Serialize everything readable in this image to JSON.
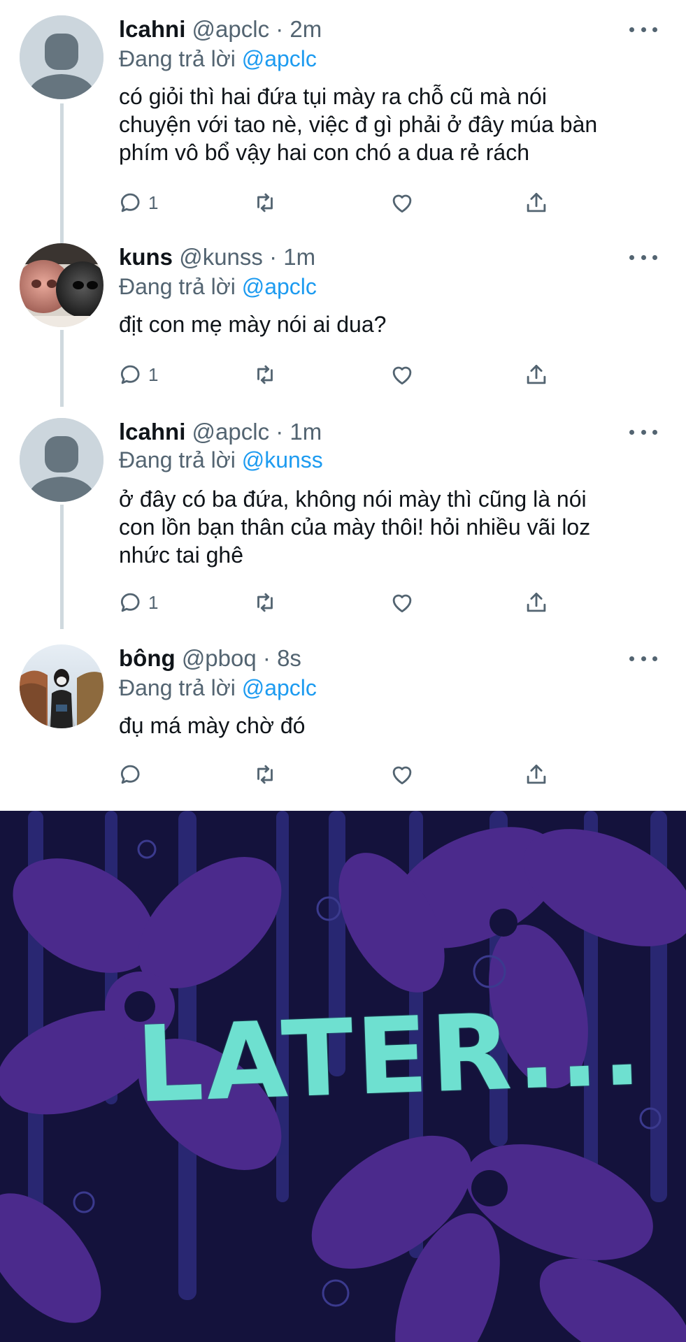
{
  "tweets": [
    {
      "name": "lcahni",
      "handle": "@apclc",
      "dot": "·",
      "time": "2m",
      "reply_prefix": "Đang trả lời",
      "reply_to": "@apclc",
      "lines": [
        "có giỏi thì hai đứa tụi mày ra chỗ cũ mà nói",
        "chuyện với tao nè, việc đ gì phải ở đây múa bàn",
        "phím vô bổ vậy hai con chó a dua rẻ rách"
      ],
      "reply_count": "1",
      "avatar": "default-avatar"
    },
    {
      "name": "kuns",
      "handle": "@kunss",
      "dot": "·",
      "time": "1m",
      "reply_prefix": "Đang trả lời",
      "reply_to": "@apclc",
      "lines": [
        "địt con mẹ mày nói ai dua?"
      ],
      "reply_count": "1",
      "avatar": "dog-nose-photo"
    },
    {
      "name": "lcahni",
      "handle": "@apclc",
      "dot": "·",
      "time": "1m",
      "reply_prefix": "Đang trả lời",
      "reply_to": "@kunss",
      "lines": [
        "ở đây có ba đứa, không nói mày thì cũng là nói",
        "con lồn bạn thân của mày thôi! hỏi nhiều vãi loz",
        "nhức tai ghê"
      ],
      "reply_count": "1",
      "avatar": "default-avatar"
    },
    {
      "name": "bông",
      "handle": "@pboq",
      "dot": "·",
      "time": "8s",
      "reply_prefix": "Đang trả lời",
      "reply_to": "@apclc",
      "lines": [
        "đụ má mày chờ đó"
      ],
      "reply_count": "",
      "avatar": "person-photo"
    }
  ],
  "icons": {
    "reply": "reply-icon",
    "retweet": "retweet-icon",
    "like": "heart-icon",
    "share": "share-icon",
    "more": "more-icon"
  },
  "meme": {
    "caption": "LATER...",
    "caption_color": "#6ee0d0",
    "background_color": "#12123a",
    "flower_color": "#4b2a8c"
  },
  "colors": {
    "link": "#1d9bf0",
    "secondary_text": "#536471",
    "thread_line": "#cfd9de"
  }
}
